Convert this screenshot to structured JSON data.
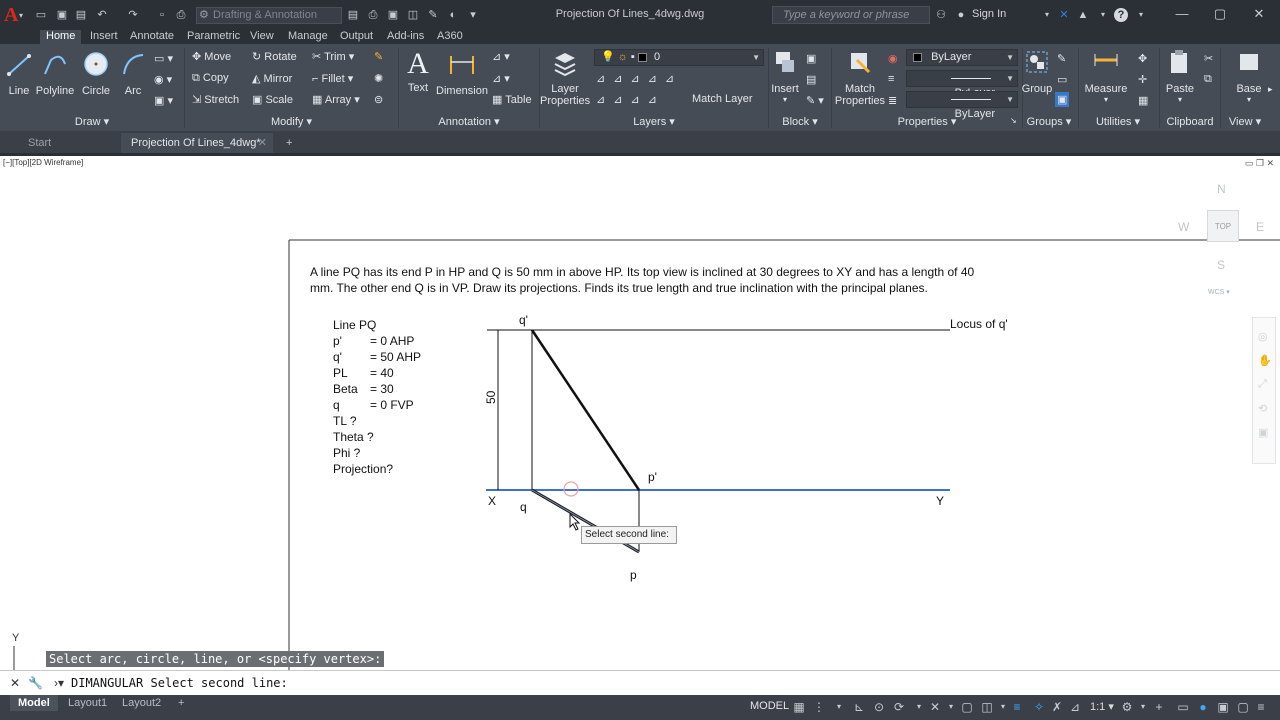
{
  "titlebar": {
    "workspace": "Drafting & Annotation",
    "title": "Projection Of Lines_4dwg.dwg",
    "search_placeholder": "Type a keyword or phrase",
    "signin": "Sign In"
  },
  "ribbon_tabs": [
    "Home",
    "Insert",
    "Annotate",
    "Parametric",
    "View",
    "Manage",
    "Output",
    "Add-ins",
    "A360"
  ],
  "ribbon": {
    "draw": {
      "title": "Draw",
      "line": "Line",
      "polyline": "Polyline",
      "circle": "Circle",
      "arc": "Arc"
    },
    "modify": {
      "title": "Modify",
      "move": "Move",
      "rotate": "Rotate",
      "trim": "Trim",
      "copy": "Copy",
      "mirror": "Mirror",
      "fillet": "Fillet",
      "stretch": "Stretch",
      "scale": "Scale",
      "array": "Array"
    },
    "annotation": {
      "title": "Annotation",
      "text": "Text",
      "dimension": "Dimension",
      "table": "Table"
    },
    "layers": {
      "title": "Layers",
      "layer_properties_1": "Layer",
      "layer_properties_2": "Properties",
      "current_layer": "0",
      "match_layer": "Match Layer"
    },
    "block": {
      "title": "Block",
      "insert": "Insert"
    },
    "properties": {
      "title": "Properties",
      "match_1": "Match",
      "match_2": "Properties",
      "color": "ByLayer",
      "linetype": "ByLayer",
      "lineweight": "ByLayer"
    },
    "groups": {
      "title": "Groups",
      "group": "Group"
    },
    "utilities": {
      "title": "Utilities",
      "measure": "Measure"
    },
    "clipboard": {
      "title": "Clipboard",
      "paste": "Paste"
    },
    "view": {
      "title": "View",
      "base": "Base"
    }
  },
  "file_tabs": {
    "start": "Start",
    "drawing": "Projection Of Lines_4dwg*"
  },
  "viewport": {
    "label": "[−][Top][2D Wireframe]",
    "viewcube": {
      "north": "N",
      "west": "W",
      "east": "E",
      "south": "S",
      "top": "TOP",
      "wcs": "WCS"
    }
  },
  "drawing": {
    "problem_line1": "A line PQ has its end P in HP and Q is 50 mm in above HP. Its top view is inclined at 30 degrees to XY and has a length of 40",
    "problem_line2": "mm. The other end Q is in VP. Draw its projections. Finds its true length and true inclination with the principal planes.",
    "given": [
      {
        "k": "Line PQ",
        "v": ""
      },
      {
        "k": "p'",
        "v": "= 0 AHP"
      },
      {
        "k": "q'",
        "v": "= 50 AHP"
      },
      {
        "k": "PL",
        "v": "= 40"
      },
      {
        "k": "Beta",
        "v": "= 30"
      },
      {
        "k": "q",
        "v": "= 0 FVP"
      },
      {
        "k": "TL ?",
        "v": ""
      },
      {
        "k": "Theta ?",
        "v": ""
      },
      {
        "k": "Phi ?",
        "v": ""
      },
      {
        "k": "Projection?",
        "v": ""
      }
    ],
    "labels": {
      "q_prime": "q'",
      "locus": "Locus of q'",
      "dim_50": "50",
      "p_prime": "p'",
      "x": "X",
      "y": "Y",
      "q": "q",
      "p": "p"
    },
    "tooltip": "Select second line:"
  },
  "ucs_y": "Y",
  "command": {
    "history": "Select arc, circle, line, or <specify vertex>:",
    "current": "DIMANGULAR Select second line:"
  },
  "statusbar": {
    "tabs": [
      "Model",
      "Layout1",
      "Layout2"
    ],
    "model": "MODEL",
    "scale": "1:1"
  }
}
